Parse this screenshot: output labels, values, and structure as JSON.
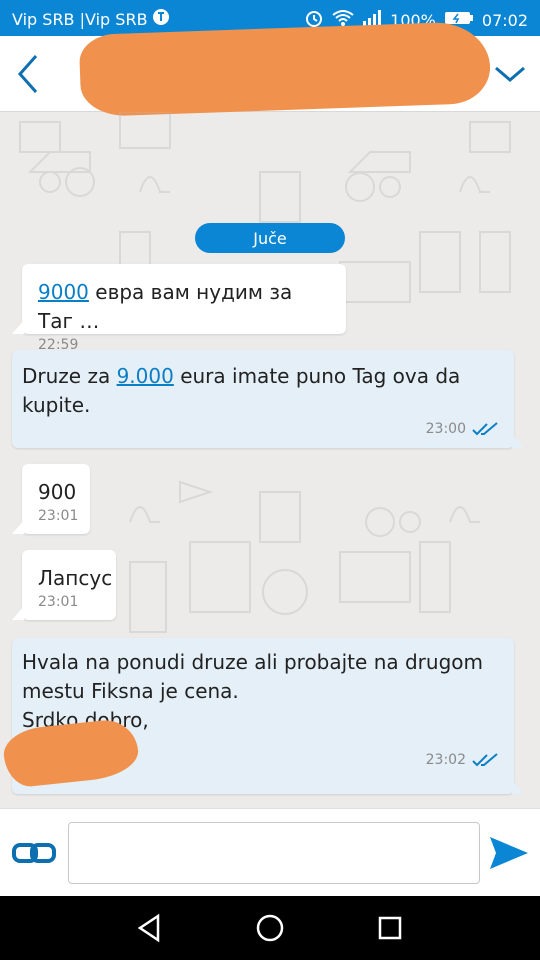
{
  "status_bar": {
    "carrier": "Vip SRB |Vip SRB",
    "battery": "100%",
    "time": "07:02"
  },
  "header": {
    "title": "",
    "back_icon": "chevron-left-icon",
    "menu_icon": "chevron-down-icon"
  },
  "chat": {
    "date_chip": "Juče",
    "messages": [
      {
        "direction": "in",
        "link": "9000",
        "text": " евра вам нудим за Таг …",
        "time": "22:59"
      },
      {
        "direction": "out",
        "text_before": "Druze za ",
        "link": "9.000",
        "text_after": " eura imate puno Tag ova da kupite.",
        "time": "23:00"
      },
      {
        "direction": "in",
        "text": "900",
        "time": "23:01"
      },
      {
        "direction": "in",
        "text": "Лапсус",
        "time": "23:01"
      },
      {
        "direction": "out",
        "line1": "Hvala na ponudi druze ali probajte na drugom",
        "line2": "mestu Fiksna je cena.",
        "line3": "Srdko dobro,",
        "time": "23:02"
      }
    ]
  },
  "composer": {
    "value": "",
    "placeholder": "",
    "attach_icon": "link-icon",
    "send_icon": "send-icon"
  },
  "colors": {
    "accent": "#0b86d4",
    "outgoing_bubble": "#e4eff7",
    "redaction": "#f0924d"
  }
}
